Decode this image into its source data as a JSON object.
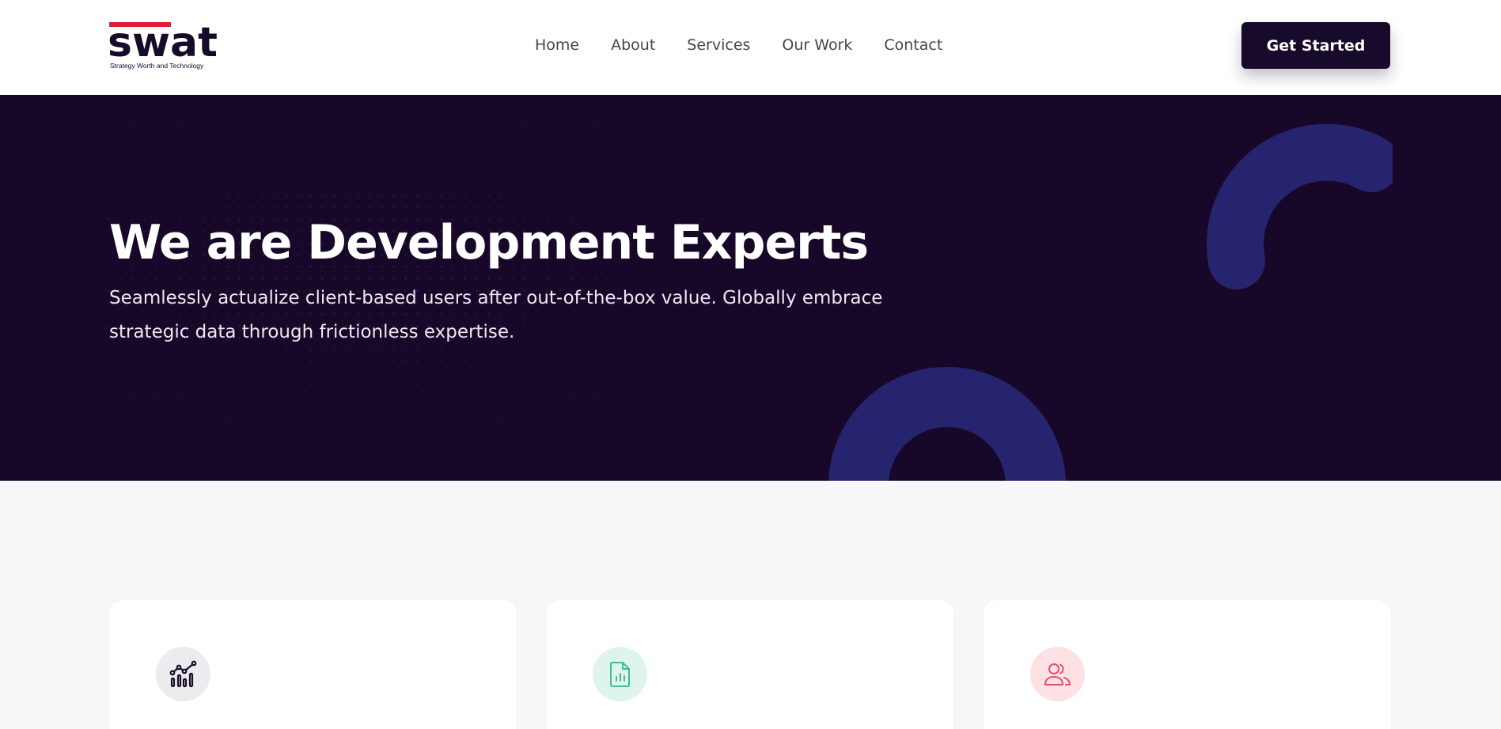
{
  "brand": {
    "name": "swat",
    "tagline": "Strategy Worth and Technology",
    "colors": {
      "primary": "#170a2a",
      "accent_red": "#e11d2e",
      "shape_blue": "#27246f"
    }
  },
  "nav": {
    "items": [
      {
        "label": "Home"
      },
      {
        "label": "About"
      },
      {
        "label": "Services"
      },
      {
        "label": "Our Work"
      },
      {
        "label": "Contact"
      }
    ],
    "cta_label": "Get Started"
  },
  "hero": {
    "title": "We are Development Experts",
    "subtitle": "Seamlessly actualize client-based users after out-of-the-box value. Globally embrace strategic data through frictionless expertise."
  },
  "cards": [
    {
      "icon": "analytics-chart-icon",
      "icon_bg": "#ececee",
      "icon_color": "#170a2a"
    },
    {
      "icon": "document-chart-icon",
      "icon_bg": "#dff5ec",
      "icon_color": "#3fbf8f"
    },
    {
      "icon": "users-icon",
      "icon_bg": "#fde1e5",
      "icon_color": "#e05069"
    }
  ]
}
